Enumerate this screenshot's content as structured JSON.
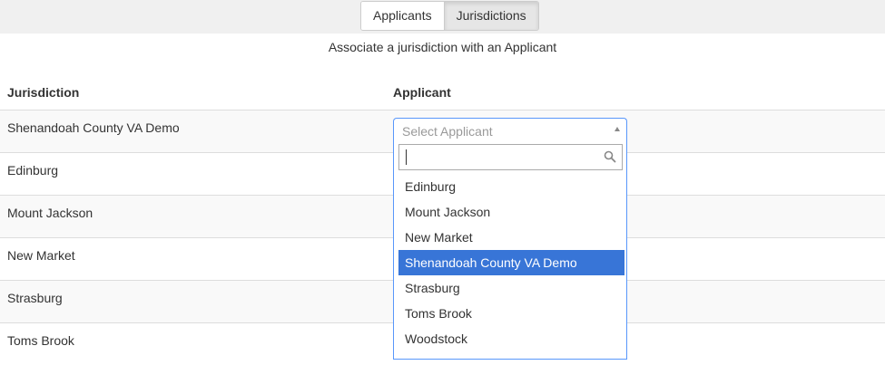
{
  "tabs": [
    {
      "label": "Applicants"
    },
    {
      "label": "Jurisdictions"
    }
  ],
  "subtitle": "Associate a jurisdiction with an Applicant",
  "columns": {
    "jurisdiction": "Jurisdiction",
    "applicant": "Applicant"
  },
  "rows": [
    {
      "jurisdiction": "Shenandoah County VA Demo"
    },
    {
      "jurisdiction": "Edinburg"
    },
    {
      "jurisdiction": "Mount Jackson"
    },
    {
      "jurisdiction": "New Market"
    },
    {
      "jurisdiction": "Strasburg"
    },
    {
      "jurisdiction": "Toms Brook"
    }
  ],
  "applicant_select": {
    "placeholder": "Select Applicant",
    "search_value": "",
    "selected_index": 3,
    "options": [
      "Edinburg",
      "Mount Jackson",
      "New Market",
      "Shenandoah County VA Demo",
      "Strasburg",
      "Toms Brook",
      "Woodstock"
    ]
  },
  "colors": {
    "highlight": "#3875d7",
    "focus_border": "#5897fb"
  },
  "icons": {
    "search": "search-icon",
    "dropdown_arrow": "triangle-up-icon"
  }
}
